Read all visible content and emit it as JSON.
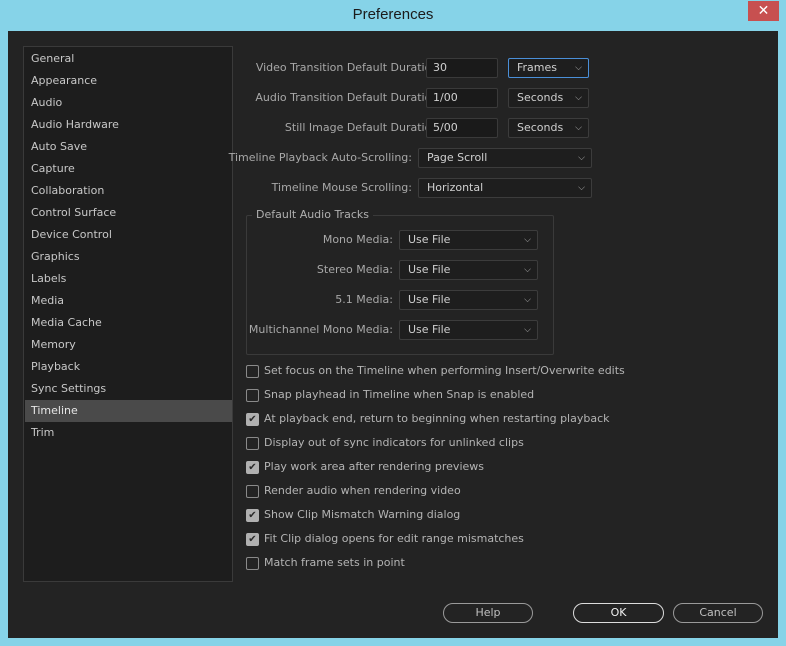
{
  "window": {
    "title": "Preferences",
    "close": "✕"
  },
  "sidebar": {
    "items": [
      "General",
      "Appearance",
      "Audio",
      "Audio Hardware",
      "Auto Save",
      "Capture",
      "Collaboration",
      "Control Surface",
      "Device Control",
      "Graphics",
      "Labels",
      "Media",
      "Media Cache",
      "Memory",
      "Playback",
      "Sync Settings",
      "Timeline",
      "Trim"
    ],
    "selected": "Timeline"
  },
  "durations": [
    {
      "label": "Video Transition Default Duration:",
      "value": "30",
      "unit": "Frames"
    },
    {
      "label": "Audio Transition Default Duration:",
      "value": "1/00",
      "unit": "Seconds"
    },
    {
      "label": "Still Image Default Duration:",
      "value": "5/00",
      "unit": "Seconds"
    }
  ],
  "scrolling": [
    {
      "label": "Timeline Playback Auto-Scrolling:",
      "value": "Page Scroll"
    },
    {
      "label": "Timeline Mouse Scrolling:",
      "value": "Horizontal"
    }
  ],
  "audio_tracks": {
    "title": "Default Audio Tracks",
    "rows": [
      {
        "label": "Mono Media:",
        "value": "Use File"
      },
      {
        "label": "Stereo Media:",
        "value": "Use File"
      },
      {
        "label": "5.1 Media:",
        "value": "Use File"
      },
      {
        "label": "Multichannel Mono Media:",
        "value": "Use File"
      }
    ]
  },
  "checkboxes": [
    {
      "label": "Set focus on the Timeline when performing Insert/Overwrite edits",
      "checked": false
    },
    {
      "label": "Snap playhead in Timeline when Snap is enabled",
      "checked": false
    },
    {
      "label": "At playback end, return to beginning when restarting playback",
      "checked": true
    },
    {
      "label": "Display out of sync indicators for unlinked clips",
      "checked": false
    },
    {
      "label": "Play work area after rendering previews",
      "checked": true
    },
    {
      "label": "Render audio when rendering video",
      "checked": false
    },
    {
      "label": "Show Clip Mismatch Warning dialog",
      "checked": true
    },
    {
      "label": "Fit Clip dialog opens for edit range mismatches",
      "checked": true
    },
    {
      "label": "Match frame sets in point",
      "checked": false
    }
  ],
  "buttons": {
    "help": "Help",
    "ok": "OK",
    "cancel": "Cancel"
  }
}
